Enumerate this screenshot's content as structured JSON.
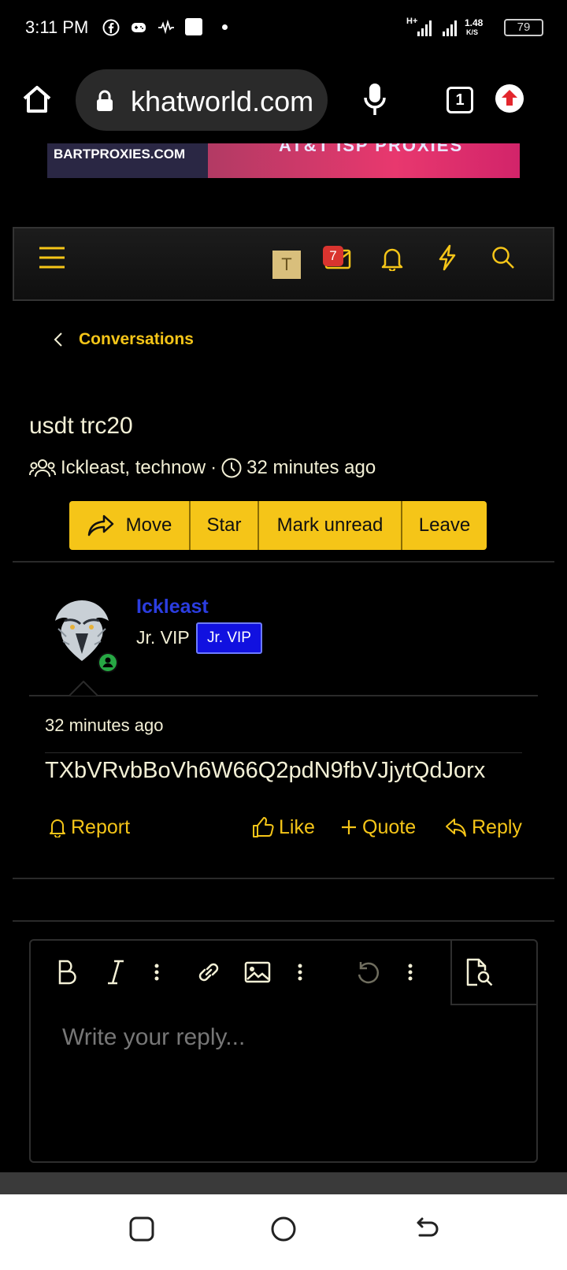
{
  "status_bar": {
    "time": "3:11 PM",
    "network_speed": "1.48",
    "network_unit": "K/S",
    "network_type": "H+",
    "battery": "79"
  },
  "browser": {
    "url": "khatworld.com",
    "tab_count": "1"
  },
  "ad": {
    "left_text": "BARTPROXIES.COM",
    "right_text": "AT&T ISP PROXIES"
  },
  "nav": {
    "avatar_letter": "T",
    "inbox_badge": "7"
  },
  "breadcrumb": {
    "label": "Conversations"
  },
  "conversation": {
    "title": "usdt trc20",
    "participants": "Ickleast, technow",
    "separator": "·",
    "time": "32 minutes ago",
    "actions": [
      "Move",
      "Star",
      "Mark unread",
      "Leave"
    ]
  },
  "message": {
    "username": "Ickleast",
    "user_title": "Jr. VIP",
    "user_banner": "Jr. VIP",
    "time": "32 minutes ago",
    "body": "TXbVRvbBoVh6W66Q2pdN9fbVJjytQdJorx",
    "report_label": "Report",
    "like_label": "Like",
    "quote_label": "Quote",
    "reply_label": "Reply"
  },
  "editor": {
    "placeholder": "Write your reply..."
  },
  "colors": {
    "accent": "#f5c518",
    "username": "#2b3de0",
    "banner": "#1111e0",
    "badge": "#d9342f",
    "text": "#f3f0d6"
  }
}
